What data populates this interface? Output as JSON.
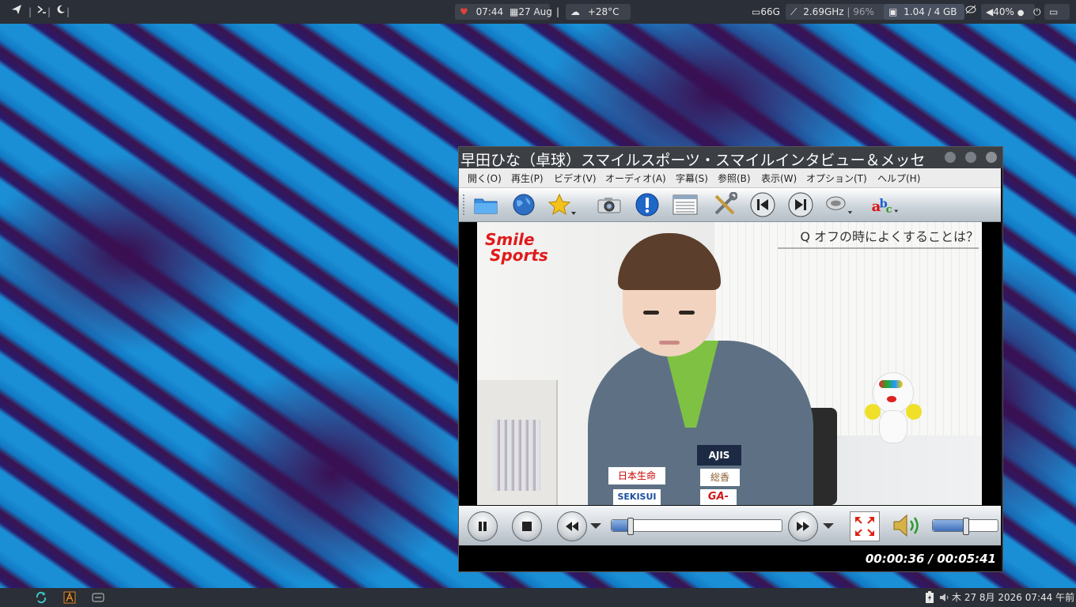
{
  "top_panel": {
    "left_icons": [
      "paper-plane-icon",
      "terminal-icon",
      "moon-icon"
    ],
    "heart_time": "07:44",
    "date": "27 Aug",
    "separator": "|",
    "weather": "+28°C",
    "disk": "66G",
    "cpu_freq": "2.69GHz",
    "cpu_load": "96%",
    "memory": "1.04 / 4 GB",
    "volume": "40%"
  },
  "player": {
    "title": "早田ひな（卓球）スマイルスポーツ・スマイルインタビュー＆メッセ",
    "menu": [
      "開く(O)",
      "再生(P)",
      "ビデオ(V)",
      "オーディオ(A)",
      "字幕(S)",
      "参照(B)",
      "表示(W)",
      "オプション(T)",
      "ヘルプ(H)"
    ],
    "toolbar": [
      "folder-icon",
      "globe-icon",
      "star-icon",
      "camera-icon",
      "info-icon",
      "playlist-icon",
      "tools-icon",
      "previous-icon",
      "next-icon",
      "audio-track-icon",
      "subtitle-icon"
    ],
    "video": {
      "logo_line1": "Smile",
      "logo_line2": "Sports",
      "question": "Q オフの時によくすることは？",
      "badge_brand": "AJIS",
      "badge_sponsor1": "日本生命",
      "badge_sponsor2": "SEKISUI",
      "badge_sponsor3": "GA-",
      "badge_sponsor4": "総香"
    },
    "seek_fraction": 0.106,
    "volume_fraction": 0.5,
    "time_display": "00:00:36 / 00:05:41",
    "colors": {
      "accent": "#4a7ec8",
      "title_bg": "#3c3f44"
    }
  },
  "bottom_panel": {
    "clock": "木 27  8月 2026 07:44 午前"
  }
}
